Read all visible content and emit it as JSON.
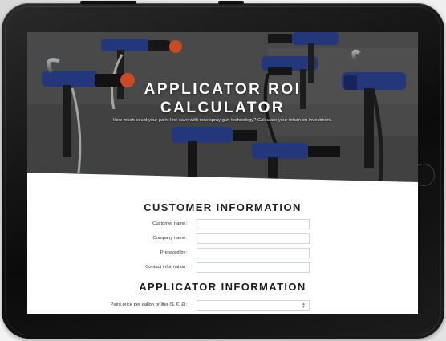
{
  "hero": {
    "title_line1": "APPLICATOR ROI",
    "title_line2": "CALCULATOR",
    "subtitle": "How much could your paint line save with new spray gun technology? Calculate your return on investment."
  },
  "customer": {
    "heading": "CUSTOMER INFORMATION",
    "fields": [
      {
        "label": "Customer name:",
        "value": ""
      },
      {
        "label": "Company name:",
        "value": ""
      },
      {
        "label": "Prepared by:",
        "value": ""
      },
      {
        "label": "Contact information:",
        "value": ""
      }
    ]
  },
  "applicator": {
    "heading": "APPLICATOR INFORMATION",
    "paint_price_label": "Paint price per gallon or liter ($, €, £):",
    "paint_price_value": ""
  },
  "colors": {
    "accent_orange": "#e8552a",
    "gun_blue": "#2b3f8c",
    "heading_dark": "#1f1f1f"
  }
}
